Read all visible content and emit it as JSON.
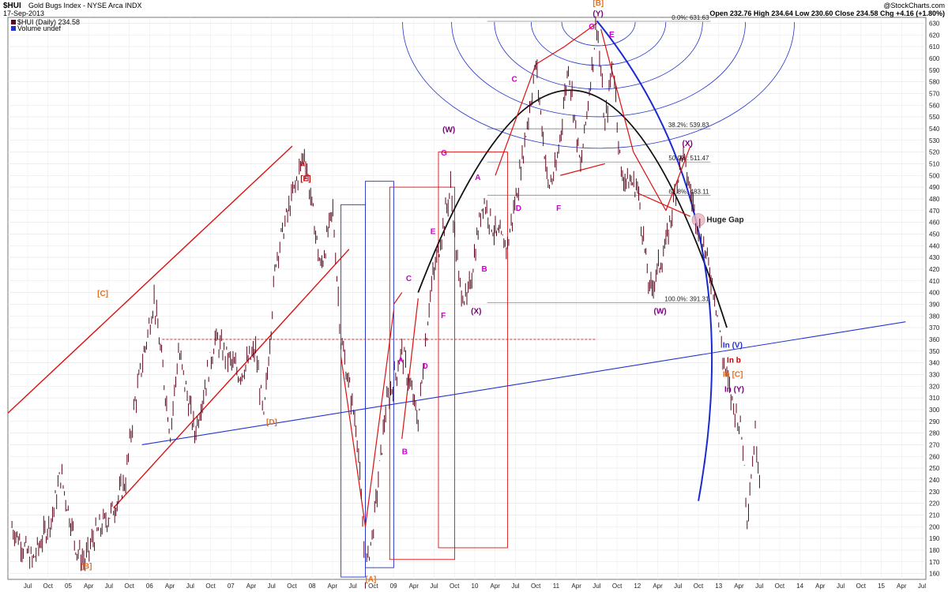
{
  "header": {
    "symbol": "$HUI",
    "name": "Gold Bugs Index - NYSE Arca INDX",
    "date": "17-Sep-2013",
    "source": "@StockCharts.com",
    "ohlc": "Open 232.76  High 234.64  Low 230.60  Close 234.58  Chg +4.16 (+1.80%)",
    "legend_price": "$HUI (Daily) 234.58",
    "legend_volume": "Volume undef"
  },
  "chart_data": {
    "type": "line",
    "title": "Gold Bugs Index - NYSE Arca INDX",
    "ylim": [
      155,
      635
    ],
    "y_ticks": [
      160,
      170,
      180,
      190,
      200,
      210,
      220,
      230,
      240,
      250,
      260,
      270,
      280,
      290,
      300,
      310,
      320,
      330,
      340,
      350,
      360,
      370,
      380,
      390,
      400,
      410,
      420,
      430,
      440,
      450,
      460,
      470,
      480,
      490,
      500,
      510,
      520,
      530,
      540,
      550,
      560,
      570,
      580,
      590,
      600,
      610,
      620,
      630
    ],
    "x_tick_labels": [
      "Jul",
      "Oct",
      "05",
      "Apr",
      "Jul",
      "Oct",
      "06",
      "Apr",
      "Jul",
      "Oct",
      "07",
      "Apr",
      "Jul",
      "Oct",
      "08",
      "Apr",
      "Jul",
      "Oct",
      "09",
      "Apr",
      "Jul",
      "Oct",
      "10",
      "Apr",
      "Jul",
      "Oct",
      "11",
      "Apr",
      "Jul",
      "Oct",
      "12",
      "Apr",
      "Jul",
      "Oct",
      "13",
      "Apr",
      "Jul",
      "Oct",
      "14",
      "Apr",
      "Jul",
      "Oct",
      "15",
      "Apr",
      "Jul"
    ],
    "series": [
      {
        "values": [
          [
            2004.5,
            200
          ],
          [
            2004.75,
            170
          ],
          [
            2005.0,
            210
          ],
          [
            2005.1,
            245
          ],
          [
            2005.3,
            180
          ],
          [
            2005.4,
            170
          ],
          [
            2005.5,
            190
          ],
          [
            2005.75,
            215
          ],
          [
            2005.9,
            240
          ],
          [
            2006.0,
            300
          ],
          [
            2006.25,
            395
          ],
          [
            2006.45,
            280
          ],
          [
            2006.55,
            350
          ],
          [
            2006.75,
            280
          ],
          [
            2007.0,
            360
          ],
          [
            2007.3,
            330
          ],
          [
            2007.5,
            350
          ],
          [
            2007.6,
            290
          ],
          [
            2007.75,
            430
          ],
          [
            2008.1,
            520
          ],
          [
            2008.3,
            420
          ],
          [
            2008.45,
            470
          ],
          [
            2008.55,
            360
          ],
          [
            2008.75,
            280
          ],
          [
            2008.85,
            160
          ],
          [
            2008.95,
            200
          ],
          [
            2009.1,
            300
          ],
          [
            2009.3,
            350
          ],
          [
            2009.5,
            290
          ],
          [
            2009.65,
            400
          ],
          [
            2009.9,
            490
          ],
          [
            2010.0,
            410
          ],
          [
            2010.1,
            390
          ],
          [
            2010.3,
            480
          ],
          [
            2010.45,
            450
          ],
          [
            2010.6,
            440
          ],
          [
            2010.75,
            500
          ],
          [
            2010.95,
            595
          ],
          [
            2011.1,
            490
          ],
          [
            2011.2,
            505
          ],
          [
            2011.35,
            595
          ],
          [
            2011.5,
            505
          ],
          [
            2011.7,
            632
          ],
          [
            2011.8,
            540
          ],
          [
            2011.9,
            600
          ],
          [
            2012.0,
            500
          ],
          [
            2012.2,
            490
          ],
          [
            2012.35,
            400
          ],
          [
            2012.55,
            440
          ],
          [
            2012.75,
            520
          ],
          [
            2012.9,
            470
          ],
          [
            2013.0,
            445
          ],
          [
            2013.15,
            400
          ],
          [
            2013.25,
            345
          ],
          [
            2013.35,
            310
          ],
          [
            2013.45,
            290
          ],
          [
            2013.5,
            270
          ],
          [
            2013.55,
            210
          ],
          [
            2013.65,
            280
          ],
          [
            2013.72,
            234.58
          ]
        ]
      }
    ],
    "annotations": [
      "[C]",
      "[B]",
      "[D]",
      "a",
      "[E]",
      "[A]",
      "A",
      "B",
      "C",
      "D",
      "E",
      "F",
      "G",
      "(W)",
      "(X)",
      "(Y)",
      "[B]",
      "C",
      "D",
      "E",
      "F",
      "G",
      "(X)",
      "(W)",
      "Huge Gap",
      "In (V)",
      "In b",
      "In [C]",
      "In (Y)"
    ],
    "fib_levels": [
      {
        "label": "0.0%: 631.63",
        "value": 631.63
      },
      {
        "label": "38.2%: 539.83",
        "value": 539.83
      },
      {
        "label": "50.0%: 511.47",
        "value": 511.47
      },
      {
        "label": "61.8%: 483.11",
        "value": 483.11
      },
      {
        "label": "100.0%: 391.31",
        "value": 391.31
      }
    ],
    "colors": {
      "price": "#5b0a1e",
      "trendline_red": "#dd1010",
      "trendline_blue": "#2233cc",
      "arc_black": "#111111",
      "magenta": "#cc00cc",
      "orange": "#e87020",
      "purple": "#770077",
      "fib": "#888888"
    },
    "grid": true,
    "legend": "top-left"
  }
}
